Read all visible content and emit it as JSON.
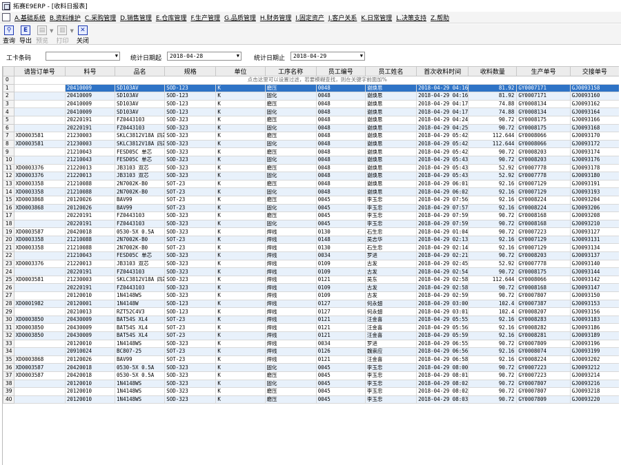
{
  "window": {
    "title": "拓赛E9ERP - [收料日报表]"
  },
  "menu": [
    "A.基础系统",
    "B.资料维护",
    "C.采购管理",
    "D.销售管理",
    "E.仓库管理",
    "F.生产管理",
    "G.品质管理",
    "H.财务管理",
    "I.固定资产",
    "J.客户关系",
    "K.日常管理",
    "L.决策支持",
    "Z.帮助"
  ],
  "toolbar": [
    {
      "label": "查询",
      "icon": "search-icon",
      "glyph": "⚲",
      "enabled": true
    },
    {
      "label": "导出",
      "icon": "export-icon",
      "glyph": "E",
      "enabled": true
    },
    {
      "label": "预览",
      "icon": "preview-icon",
      "glyph": "▤",
      "enabled": false
    },
    {
      "label": "打印",
      "icon": "printer-icon",
      "glyph": "▥",
      "enabled": false
    },
    {
      "label": "关闭",
      "icon": "close-icon",
      "glyph": "✕",
      "enabled": true
    }
  ],
  "filters": {
    "process_label": "工卡条码",
    "process_value": "",
    "date_start_label": "统计日期起",
    "date_start": "2018-04-28",
    "date_end_label": "统计日期止",
    "date_end": "2018-04-29"
  },
  "grid": {
    "columns": [
      "",
      "请皆订单号",
      "料号",
      "品名",
      "规格",
      "单位",
      "工序名称",
      "员工编号",
      "员工姓名",
      "首次收料时间",
      "收料数量",
      "生产单号",
      "交接单号"
    ],
    "filter_hint": "点击这里可以设置过滤，若要模糊查找，则在关键字前面加%",
    "filter_row_number": "0",
    "rows": [
      [
        "1",
        "",
        "20410009",
        "SD103AV",
        "SOD-123",
        "K",
        "磨压",
        "0048",
        "谢焕思",
        "2018-04-29 04:16",
        "81.92",
        "GY0007171",
        "GJ0093158"
      ],
      [
        "2",
        "",
        "20410009",
        "SD103AV",
        "SOD-123",
        "K",
        "固化",
        "0048",
        "谢焕思",
        "2018-04-29 04:16",
        "81.92",
        "GY0007171",
        "GJ0093160"
      ],
      [
        "3",
        "",
        "20410009",
        "SD103AV",
        "SOD-123",
        "K",
        "磨压",
        "0048",
        "谢焕思",
        "2018-04-29 04:17",
        "74.88",
        "GY0008134",
        "GJ0093162"
      ],
      [
        "4",
        "",
        "20410009",
        "SD103AV",
        "SOD-123",
        "K",
        "固化",
        "0048",
        "谢焕思",
        "2018-04-29 04:17",
        "74.88",
        "GY0008134",
        "GJ0093164"
      ],
      [
        "5",
        "",
        "20220191",
        "FZ0443103",
        "SOD-323",
        "K",
        "磨压",
        "0048",
        "谢焕思",
        "2018-04-29 04:24",
        "90.72",
        "GY0008175",
        "GJ0093166"
      ],
      [
        "6",
        "",
        "20220191",
        "FZ0443103",
        "SOD-323",
        "K",
        "固化",
        "0048",
        "谢焕思",
        "2018-04-29 04:25",
        "90.72",
        "GY0008175",
        "GJ0093168"
      ],
      [
        "7",
        "XD0003581",
        "21230003",
        "SKLC3812V18A 四芯",
        "SOD-323",
        "K",
        "磨压",
        "0048",
        "谢焕思",
        "2018-04-29 05:42",
        "112.644",
        "GY0008066",
        "GJ0093170"
      ],
      [
        "8",
        "XD0003581",
        "21230003",
        "SKLC3812V18A 四芯",
        "SOD-323",
        "K",
        "固化",
        "0048",
        "谢焕思",
        "2018-04-29 05:42",
        "112.644",
        "GY0008066",
        "GJ0093172"
      ],
      [
        "9",
        "",
        "21210043",
        "FESD05C 单芯",
        "SOD-323",
        "K",
        "磨压",
        "0048",
        "谢焕思",
        "2018-04-29 05:42",
        "90.72",
        "GY0008203",
        "GJ0093174"
      ],
      [
        "10",
        "",
        "21210043",
        "FESD05C 单芯",
        "SOD-323",
        "K",
        "固化",
        "0048",
        "谢焕思",
        "2018-04-29 05:43",
        "90.72",
        "GY0008203",
        "GJ0093176"
      ],
      [
        "11",
        "XD0003376",
        "21220013",
        "JB3103 双芯",
        "SOD-323",
        "K",
        "磨压",
        "0048",
        "谢焕思",
        "2018-04-29 05:43",
        "52.92",
        "GY0007778",
        "GJ0093178"
      ],
      [
        "12",
        "XD0003376",
        "21220013",
        "JB3103 双芯",
        "SOD-323",
        "K",
        "固化",
        "0048",
        "谢焕思",
        "2018-04-29 05:43",
        "52.92",
        "GY0007778",
        "GJ0093180"
      ],
      [
        "13",
        "XD0003358",
        "21210088",
        "2N7002K-B0",
        "SOT-23",
        "K",
        "磨压",
        "0048",
        "谢焕思",
        "2018-04-29 06:01",
        "92.16",
        "GY0007129",
        "GJ0093191"
      ],
      [
        "14",
        "XD0003358",
        "21210088",
        "2N7002K-B0",
        "SOT-23",
        "K",
        "固化",
        "0048",
        "谢焕思",
        "2018-04-29 06:02",
        "92.16",
        "GY0007129",
        "GJ0093193"
      ],
      [
        "15",
        "XD0003868",
        "20120026",
        "BAV99",
        "SOT-23",
        "K",
        "磨压",
        "0045",
        "李玉忠",
        "2018-04-29 07:56",
        "92.16",
        "GY0008224",
        "GJ0093204"
      ],
      [
        "16",
        "XD0003868",
        "20120026",
        "BAV99",
        "SOT-23",
        "K",
        "固化",
        "0045",
        "李玉忠",
        "2018-04-29 07:57",
        "92.16",
        "GY0008224",
        "GJ0093206"
      ],
      [
        "17",
        "",
        "20220191",
        "FZ0443103",
        "SOD-323",
        "K",
        "磨压",
        "0045",
        "李玉忠",
        "2018-04-29 07:59",
        "90.72",
        "GY0008168",
        "GJ0093208"
      ],
      [
        "18",
        "",
        "20220191",
        "FZ0443103",
        "SOD-323",
        "K",
        "固化",
        "0045",
        "李玉忠",
        "2018-04-29 07:59",
        "90.72",
        "GY0008168",
        "GJ0093210"
      ],
      [
        "19",
        "XD0003587",
        "20420018",
        "0530-5X 0.5A",
        "SOD-323",
        "K",
        "焊线",
        "0130",
        "石生忠",
        "2018-04-29 01:04",
        "90.72",
        "GY0007223",
        "GJ0093127"
      ],
      [
        "20",
        "XD0003358",
        "21210088",
        "2N7002K-B0",
        "SOT-23",
        "K",
        "焊线",
        "0148",
        "吴志华",
        "2018-04-29 02:13",
        "92.16",
        "GY0007129",
        "GJ0093131"
      ],
      [
        "21",
        "XD0003358",
        "21210088",
        "2N7002K-B0",
        "SOT-23",
        "K",
        "焊线",
        "0130",
        "石生忠",
        "2018-04-29 02:14",
        "92.16",
        "GY0007129",
        "GJ0093134"
      ],
      [
        "22",
        "",
        "21210043",
        "FESD05C 单芯",
        "SOD-323",
        "K",
        "焊线",
        "0034",
        "罗进",
        "2018-04-29 02:21",
        "90.72",
        "GY0008203",
        "GJ0093137"
      ],
      [
        "23",
        "XD0003376",
        "21220013",
        "JB3103 双芯",
        "SOD-323",
        "K",
        "焊线",
        "0109",
        "古发",
        "2018-04-29 02:45",
        "52.92",
        "GY0007778",
        "GJ0093140"
      ],
      [
        "24",
        "",
        "20220191",
        "FZ0443103",
        "SOD-323",
        "K",
        "焊线",
        "0109",
        "古发",
        "2018-04-29 02:54",
        "90.72",
        "GY0008175",
        "GJ0093144"
      ],
      [
        "25",
        "XD0003581",
        "21230003",
        "SKLC3812V18A 四芯",
        "SOD-323",
        "K",
        "焊线",
        "0121",
        "吴东",
        "2018-04-29 02:58",
        "112.644",
        "GY0008066",
        "GJ0093142"
      ],
      [
        "26",
        "",
        "20220191",
        "FZ0443103",
        "SOD-323",
        "K",
        "焊线",
        "0109",
        "古发",
        "2018-04-29 02:58",
        "90.72",
        "GY0008168",
        "GJ0093147"
      ],
      [
        "27",
        "",
        "20120010",
        "1N4148WS",
        "SOD-323",
        "K",
        "焊线",
        "0109",
        "古发",
        "2018-04-29 02:59",
        "90.72",
        "GY0007807",
        "GJ0093150"
      ],
      [
        "28",
        "XD0001982",
        "20120001",
        "1N4148W",
        "SOD-123",
        "K",
        "焊线",
        "0127",
        "何永翅",
        "2018-04-29 03:00",
        "102.4",
        "GY0007387",
        "GJ0093153"
      ],
      [
        "29",
        "",
        "20210013",
        "RZT52C4V3",
        "SOD-123",
        "K",
        "焊线",
        "0127",
        "何永翅",
        "2018-04-29 03:01",
        "102.4",
        "GY0008207",
        "GJ0093156"
      ],
      [
        "30",
        "XD0003850",
        "20430009",
        "BAT54S XL4",
        "SOT-23",
        "K",
        "焊线",
        "0121",
        "汪金喜",
        "2018-04-29 05:55",
        "92.16",
        "GY0008283",
        "GJ0093183"
      ],
      [
        "31",
        "XD0003850",
        "20430009",
        "BAT54S XL4",
        "SOT-23",
        "K",
        "焊线",
        "0121",
        "汪金喜",
        "2018-04-29 05:56",
        "92.16",
        "GY0008282",
        "GJ0093186"
      ],
      [
        "32",
        "XD0003850",
        "20430009",
        "BAT54S XL4",
        "SOT-23",
        "K",
        "焊线",
        "0121",
        "汪金喜",
        "2018-04-29 05:59",
        "92.16",
        "GY0008281",
        "GJ0093189"
      ],
      [
        "33",
        "",
        "20120010",
        "1N4148WS",
        "SOD-323",
        "K",
        "焊线",
        "0034",
        "罗进",
        "2018-04-29 06:55",
        "90.72",
        "GY0007809",
        "GJ0093196"
      ],
      [
        "34",
        "",
        "20910024",
        "BC807-25",
        "SOT-23",
        "K",
        "焊线",
        "0126",
        "魏崇应",
        "2018-04-29 06:56",
        "92.16",
        "GY0008074",
        "GJ0093199"
      ],
      [
        "35",
        "XD0003868",
        "20120026",
        "BAV99",
        "SOT-23",
        "K",
        "焊线",
        "0121",
        "汪金喜",
        "2018-04-29 06:58",
        "92.16",
        "GY0008224",
        "GJ0093202"
      ],
      [
        "36",
        "XD0003587",
        "20420018",
        "0530-5X 0.5A",
        "SOD-323",
        "K",
        "固化",
        "0045",
        "李玉忠",
        "2018-04-29 08:00",
        "90.72",
        "GY0007223",
        "GJ0093212"
      ],
      [
        "37",
        "XD0003587",
        "20420018",
        "0530-5X 0.5A",
        "SOD-323",
        "K",
        "磨压",
        "0045",
        "李玉忠",
        "2018-04-29 08:01",
        "90.72",
        "GY0007223",
        "GJ0093214"
      ],
      [
        "38",
        "",
        "20120010",
        "1N4148WS",
        "SOD-323",
        "K",
        "固化",
        "0045",
        "李玉忠",
        "2018-04-29 08:02",
        "90.72",
        "GY0007807",
        "GJ0093216"
      ],
      [
        "39",
        "",
        "20120010",
        "1N4148WS",
        "SOD-323",
        "K",
        "磨压",
        "0045",
        "李玉忠",
        "2018-04-29 08:02",
        "90.72",
        "GY0007807",
        "GJ0093218"
      ],
      [
        "40",
        "",
        "20120010",
        "1N4148WS",
        "SOD-323",
        "K",
        "磨压",
        "0045",
        "李玉忠",
        "2018-04-29 08:03",
        "90.72",
        "GY0007809",
        "GJ0093220"
      ]
    ]
  },
  "colors": {
    "selection": "#2e73c6",
    "alt_row": "#e8f1fb",
    "header_bg": "#ececec",
    "toolbar_accent": "#1a36b0"
  }
}
